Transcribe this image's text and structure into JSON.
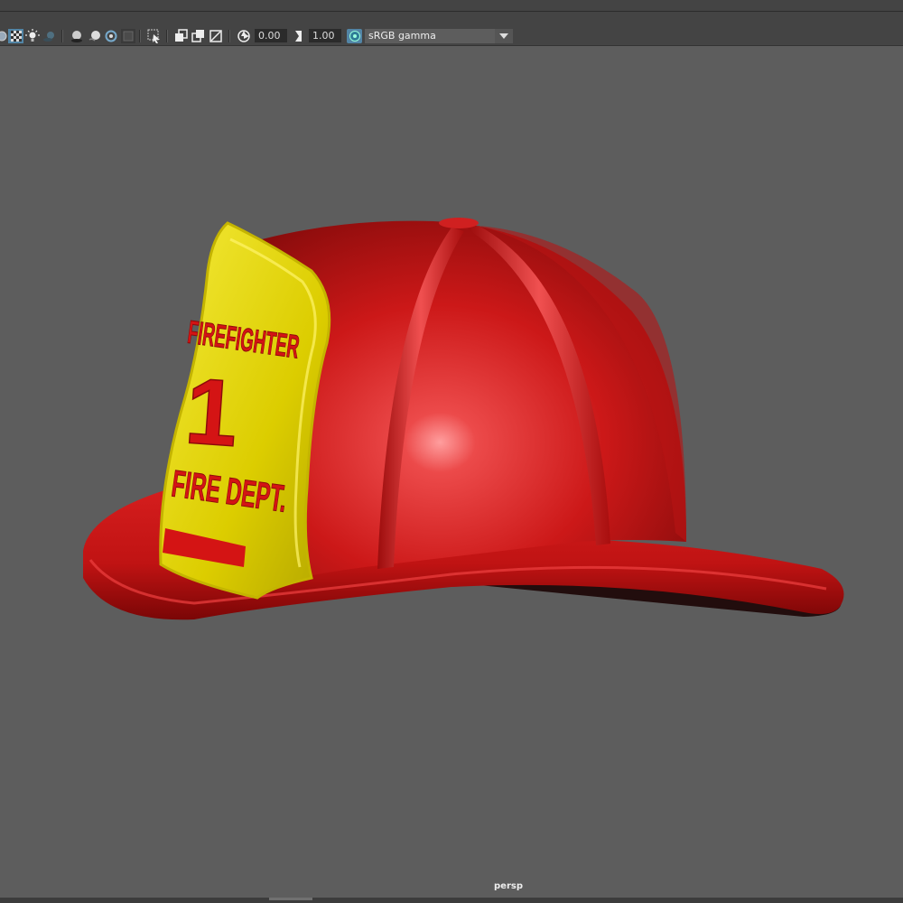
{
  "toolbar": {
    "exposure_value": "0.00",
    "gamma_value": "1.00",
    "color_space": "sRGB gamma",
    "icons": [
      "shaded-icon",
      "texture-checker-icon",
      "lights-icon",
      "shadows-icon",
      "ambient-occlusion-icon",
      "motion-blur-icon",
      "anti-alias-icon",
      "resolution-gate-icon",
      "select-icon",
      "isolate-icon",
      "xray-icon",
      "wireframe-on-shaded-icon",
      "exposure-icon",
      "gamma-icon",
      "color-management-icon",
      "dropdown-arrow-icon"
    ]
  },
  "viewport": {
    "camera_label": "persp",
    "background_color": "#5d5d5d"
  },
  "helmet": {
    "shield_text_top": "FIREFIGHTER",
    "shield_text_number": "1",
    "shield_text_bottom": "FIRE DEPT.",
    "shell_color": "#d11a1a",
    "shield_color": "#e3d400"
  }
}
